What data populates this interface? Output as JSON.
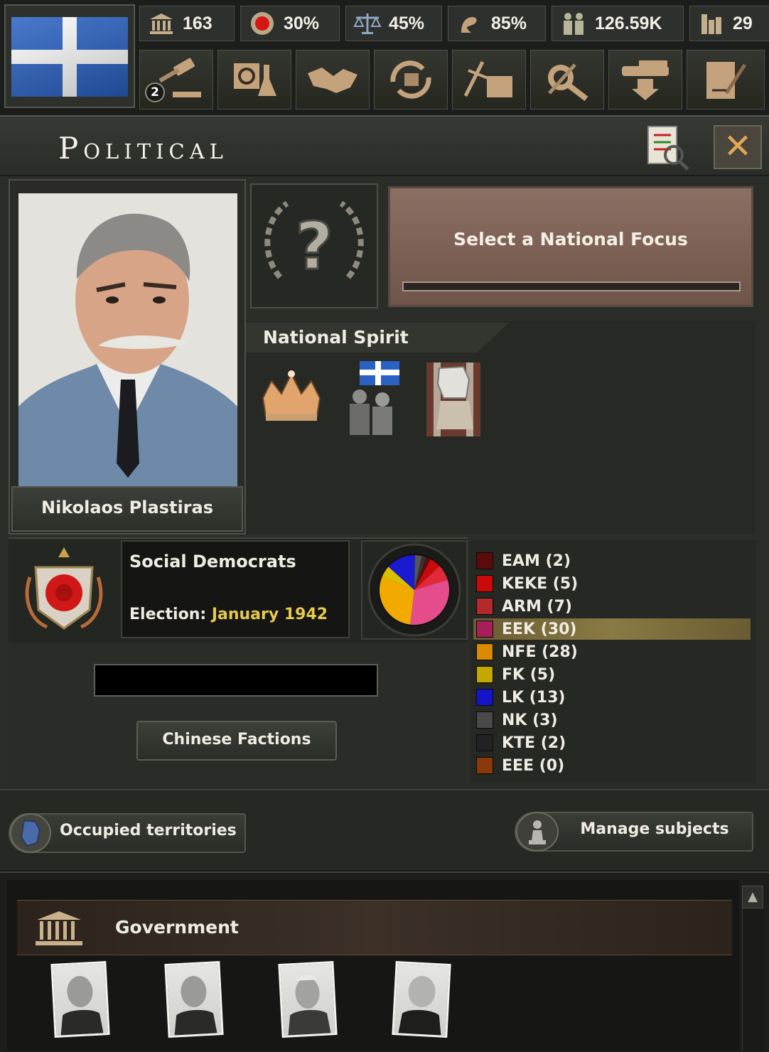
{
  "topbar": {
    "flag_icon": "greece-flag-icon",
    "resources": [
      {
        "icon": "political-power-icon",
        "value": "163"
      },
      {
        "icon": "stability-icon",
        "value": "30%"
      },
      {
        "icon": "war-support-icon",
        "value": "45%"
      },
      {
        "icon": "manpower-icon",
        "value": "85%"
      },
      {
        "icon": "soldiers-icon",
        "value": "126.59K"
      },
      {
        "icon": "factory-icon",
        "value": "29"
      }
    ],
    "toolbar": [
      {
        "icon": "decisions-gavel-icon",
        "badge": "2"
      },
      {
        "icon": "research-icon"
      },
      {
        "icon": "diplomacy-handshake-icon"
      },
      {
        "icon": "trade-icon"
      },
      {
        "icon": "construction-icon"
      },
      {
        "icon": "production-icon"
      },
      {
        "icon": "logistics-tank-icon"
      },
      {
        "icon": "intelligence-icon"
      }
    ]
  },
  "panel": {
    "title": "Political",
    "close_icon": "close-icon",
    "checklist_icon": "checklist-icon"
  },
  "leader": {
    "name": "Nikolaos Plastiras"
  },
  "focus": {
    "icon": "question-mark-icon",
    "label": "Select a National Focus",
    "progress": 0
  },
  "national_spirit": {
    "title": "National Spirit",
    "spirits": [
      {
        "icon": "crown-icon"
      },
      {
        "icon": "soldiers-with-flag-icon"
      },
      {
        "icon": "fist-on-map-icon"
      }
    ]
  },
  "party": {
    "name": "Social Democrats",
    "election_label": "Election: ",
    "election_date": "January 1942",
    "chinese_factions": "Chinese Factions",
    "list": [
      {
        "label": "EAM (2)",
        "color": "#5c0a0a"
      },
      {
        "label": "KEKE (5)",
        "color": "#c80a0a"
      },
      {
        "label": "ARM (7)",
        "color": "#b22a2a"
      },
      {
        "label": "EEK (30)",
        "color": "#a81e58",
        "selected": true
      },
      {
        "label": "NFE (28)",
        "color": "#d98a00"
      },
      {
        "label": "FK (5)",
        "color": "#c4a800"
      },
      {
        "label": "LK (13)",
        "color": "#1414c8"
      },
      {
        "label": "NK (3)",
        "color": "#4a4a4a"
      },
      {
        "label": "KTE (2)",
        "color": "#222222"
      },
      {
        "label": "EEE (0)",
        "color": "#8a3a0a"
      }
    ],
    "pie": [
      {
        "value": 2,
        "color": "#5c0a0a"
      },
      {
        "value": 5,
        "color": "#c80a0a"
      },
      {
        "value": 7,
        "color": "#e02a3a"
      },
      {
        "value": 30,
        "color": "#e44c8c"
      },
      {
        "value": 28,
        "color": "#f2a900"
      },
      {
        "value": 5,
        "color": "#d8c000"
      },
      {
        "value": 13,
        "color": "#1a1ad0"
      },
      {
        "value": 3,
        "color": "#555555"
      },
      {
        "value": 2,
        "color": "#333333"
      }
    ]
  },
  "actions": {
    "occupied": "Occupied territories",
    "subjects": "Manage subjects"
  },
  "government": {
    "title": "Government",
    "ministers": [
      {
        "icon": "minister-portrait-icon"
      },
      {
        "icon": "minister-portrait-icon"
      },
      {
        "icon": "minister-portrait-icon"
      },
      {
        "icon": "minister-portrait-icon"
      }
    ]
  }
}
